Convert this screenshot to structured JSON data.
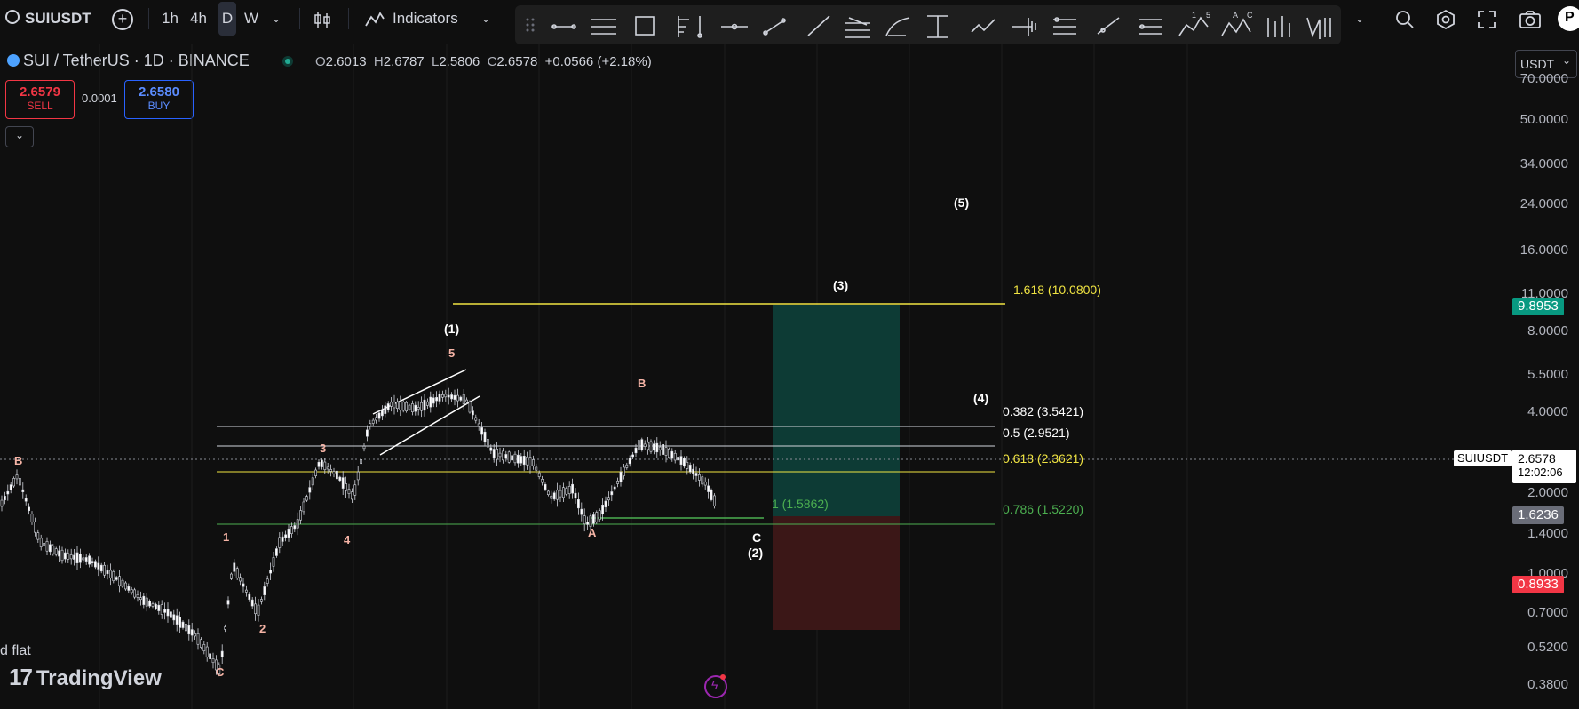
{
  "toolbar": {
    "symbol": "SUIUSDT",
    "intervals": [
      "1h",
      "4h",
      "D",
      "W"
    ],
    "indicators_label": "Indicators"
  },
  "legend": {
    "title": "SUI / TetherUS · 1D · BINANCE",
    "o_label": "O",
    "o": "2.6013",
    "h_label": "H",
    "h": "2.6787",
    "l_label": "L",
    "l": "2.5806",
    "c_label": "C",
    "c": "2.6578",
    "change": "+0.0566 (+2.18%)",
    "sell_price": "2.6579",
    "sell_label": "SELL",
    "spread": "0.0001",
    "buy_price": "2.6580",
    "buy_label": "BUY"
  },
  "axis": {
    "currency": "USDT",
    "labels": [
      "70.0000",
      "50.0000",
      "34.0000",
      "24.0000",
      "16.0000",
      "11.0000",
      "8.0000",
      "5.5000",
      "4.0000",
      "2.0000",
      "1.4000",
      "1.0000",
      "0.7000",
      "0.5200",
      "0.3800"
    ],
    "tags": {
      "target": "9.8953",
      "symbol_tag": "SUIUSDT",
      "price": "2.6578",
      "countdown": "12:02:06",
      "entry": "1.6236",
      "stop": "0.8933"
    }
  },
  "fib": {
    "f1618": "1.618 (10.0800)",
    "f0382": "0.382 (3.5421)",
    "f05": "0.5 (2.9521)",
    "f0618": "0.618 (2.3621)",
    "f0786": "0.786 (1.5220)",
    "f1": "1 (1.5862)"
  },
  "waves": {
    "p1": "(1)",
    "p2": "(2)",
    "p3": "(3)",
    "p4": "(4)",
    "p5": "(5)",
    "s1": "1",
    "s2": "2",
    "s3": "3",
    "s4": "4",
    "s5": "5",
    "a": "A",
    "b": "B",
    "c": "C",
    "b_left": "B",
    "c_left": "C"
  },
  "watermark": "TradingView",
  "note": "d flat",
  "colors": {
    "sell": "#f23645",
    "buy": "#2962ff",
    "fib_yellow": "#f0e442",
    "fib_green": "#4caf50",
    "target_tag": "#089981",
    "stop_tag": "#f23645",
    "long_zone": "#0d3b35",
    "short_zone": "#3b1717",
    "wave_small": "#f6b4a6"
  }
}
